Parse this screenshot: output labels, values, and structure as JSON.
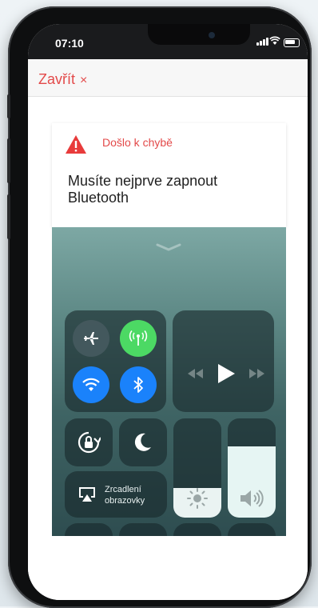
{
  "status_bar": {
    "time": "07:10"
  },
  "topbar": {
    "close_label": "Zavřít",
    "close_symbol": "×"
  },
  "error_card": {
    "title": "Došlo k chybě",
    "message": "Musíte nejprve zapnout Bluetooth"
  },
  "control_center": {
    "screen_mirroring": {
      "line1": "Zrcadlení",
      "line2": "obrazovky"
    },
    "brightness_level": 0.3,
    "volume_level": 0.72,
    "icons": [
      "airplane-icon",
      "cellular-data-icon",
      "wifi-icon",
      "bluetooth-icon",
      "rewind-icon",
      "play-icon",
      "fast-forward-icon",
      "orientation-lock-icon",
      "moon-icon",
      "airplay-icon",
      "sun-icon",
      "speaker-icon"
    ]
  },
  "colors": {
    "accent": "#e34a4a",
    "green": "#4cd964",
    "blue": "#1a82fb"
  }
}
